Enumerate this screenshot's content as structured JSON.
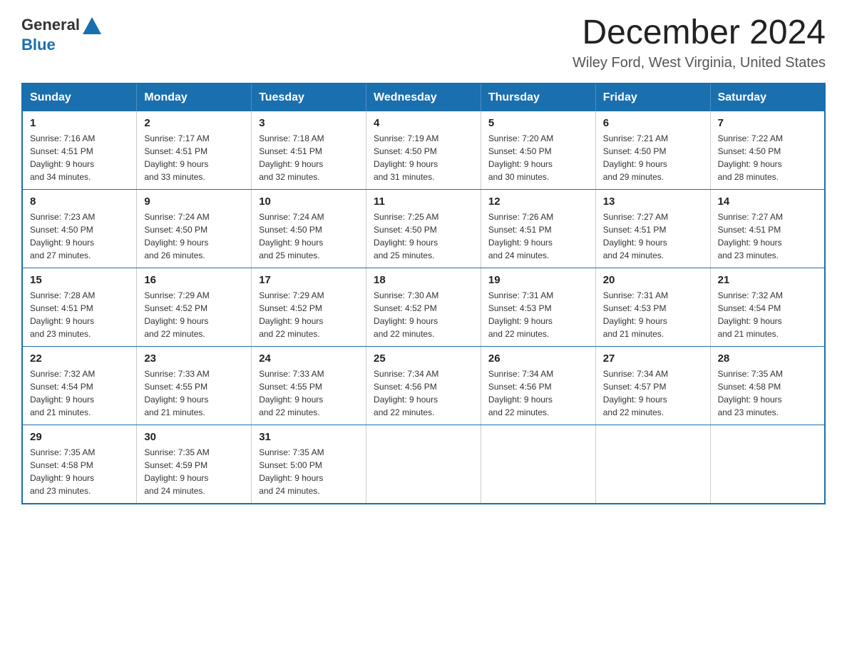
{
  "header": {
    "logo": {
      "text_general": "General",
      "text_blue": "Blue",
      "icon_title": "GeneralBlue logo"
    },
    "month_title": "December 2024",
    "location": "Wiley Ford, West Virginia, United States"
  },
  "weekdays": [
    "Sunday",
    "Monday",
    "Tuesday",
    "Wednesday",
    "Thursday",
    "Friday",
    "Saturday"
  ],
  "weeks": [
    [
      {
        "day": "1",
        "sunrise": "7:16 AM",
        "sunset": "4:51 PM",
        "daylight": "9 hours and 34 minutes."
      },
      {
        "day": "2",
        "sunrise": "7:17 AM",
        "sunset": "4:51 PM",
        "daylight": "9 hours and 33 minutes."
      },
      {
        "day": "3",
        "sunrise": "7:18 AM",
        "sunset": "4:51 PM",
        "daylight": "9 hours and 32 minutes."
      },
      {
        "day": "4",
        "sunrise": "7:19 AM",
        "sunset": "4:50 PM",
        "daylight": "9 hours and 31 minutes."
      },
      {
        "day": "5",
        "sunrise": "7:20 AM",
        "sunset": "4:50 PM",
        "daylight": "9 hours and 30 minutes."
      },
      {
        "day": "6",
        "sunrise": "7:21 AM",
        "sunset": "4:50 PM",
        "daylight": "9 hours and 29 minutes."
      },
      {
        "day": "7",
        "sunrise": "7:22 AM",
        "sunset": "4:50 PM",
        "daylight": "9 hours and 28 minutes."
      }
    ],
    [
      {
        "day": "8",
        "sunrise": "7:23 AM",
        "sunset": "4:50 PM",
        "daylight": "9 hours and 27 minutes."
      },
      {
        "day": "9",
        "sunrise": "7:24 AM",
        "sunset": "4:50 PM",
        "daylight": "9 hours and 26 minutes."
      },
      {
        "day": "10",
        "sunrise": "7:24 AM",
        "sunset": "4:50 PM",
        "daylight": "9 hours and 25 minutes."
      },
      {
        "day": "11",
        "sunrise": "7:25 AM",
        "sunset": "4:50 PM",
        "daylight": "9 hours and 25 minutes."
      },
      {
        "day": "12",
        "sunrise": "7:26 AM",
        "sunset": "4:51 PM",
        "daylight": "9 hours and 24 minutes."
      },
      {
        "day": "13",
        "sunrise": "7:27 AM",
        "sunset": "4:51 PM",
        "daylight": "9 hours and 24 minutes."
      },
      {
        "day": "14",
        "sunrise": "7:27 AM",
        "sunset": "4:51 PM",
        "daylight": "9 hours and 23 minutes."
      }
    ],
    [
      {
        "day": "15",
        "sunrise": "7:28 AM",
        "sunset": "4:51 PM",
        "daylight": "9 hours and 23 minutes."
      },
      {
        "day": "16",
        "sunrise": "7:29 AM",
        "sunset": "4:52 PM",
        "daylight": "9 hours and 22 minutes."
      },
      {
        "day": "17",
        "sunrise": "7:29 AM",
        "sunset": "4:52 PM",
        "daylight": "9 hours and 22 minutes."
      },
      {
        "day": "18",
        "sunrise": "7:30 AM",
        "sunset": "4:52 PM",
        "daylight": "9 hours and 22 minutes."
      },
      {
        "day": "19",
        "sunrise": "7:31 AM",
        "sunset": "4:53 PM",
        "daylight": "9 hours and 22 minutes."
      },
      {
        "day": "20",
        "sunrise": "7:31 AM",
        "sunset": "4:53 PM",
        "daylight": "9 hours and 21 minutes."
      },
      {
        "day": "21",
        "sunrise": "7:32 AM",
        "sunset": "4:54 PM",
        "daylight": "9 hours and 21 minutes."
      }
    ],
    [
      {
        "day": "22",
        "sunrise": "7:32 AM",
        "sunset": "4:54 PM",
        "daylight": "9 hours and 21 minutes."
      },
      {
        "day": "23",
        "sunrise": "7:33 AM",
        "sunset": "4:55 PM",
        "daylight": "9 hours and 21 minutes."
      },
      {
        "day": "24",
        "sunrise": "7:33 AM",
        "sunset": "4:55 PM",
        "daylight": "9 hours and 22 minutes."
      },
      {
        "day": "25",
        "sunrise": "7:34 AM",
        "sunset": "4:56 PM",
        "daylight": "9 hours and 22 minutes."
      },
      {
        "day": "26",
        "sunrise": "7:34 AM",
        "sunset": "4:56 PM",
        "daylight": "9 hours and 22 minutes."
      },
      {
        "day": "27",
        "sunrise": "7:34 AM",
        "sunset": "4:57 PM",
        "daylight": "9 hours and 22 minutes."
      },
      {
        "day": "28",
        "sunrise": "7:35 AM",
        "sunset": "4:58 PM",
        "daylight": "9 hours and 23 minutes."
      }
    ],
    [
      {
        "day": "29",
        "sunrise": "7:35 AM",
        "sunset": "4:58 PM",
        "daylight": "9 hours and 23 minutes."
      },
      {
        "day": "30",
        "sunrise": "7:35 AM",
        "sunset": "4:59 PM",
        "daylight": "9 hours and 24 minutes."
      },
      {
        "day": "31",
        "sunrise": "7:35 AM",
        "sunset": "5:00 PM",
        "daylight": "9 hours and 24 minutes."
      },
      null,
      null,
      null,
      null
    ]
  ],
  "labels": {
    "sunrise": "Sunrise:",
    "sunset": "Sunset:",
    "daylight": "Daylight:"
  }
}
